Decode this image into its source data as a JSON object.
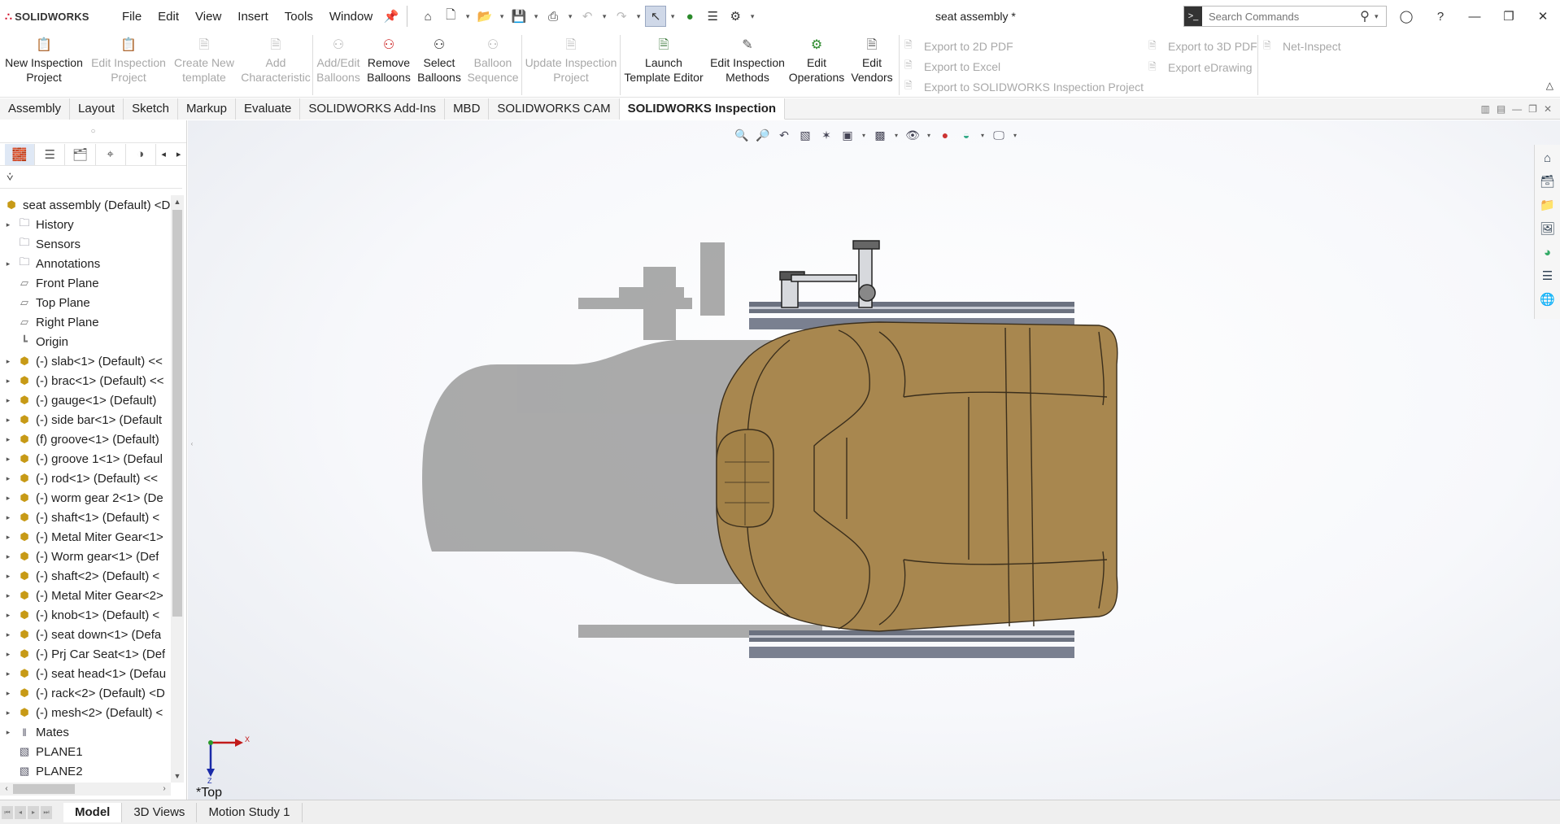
{
  "app": {
    "logo_text": "SOLIDWORKS",
    "document_title": "seat assembly *"
  },
  "menu": [
    "File",
    "Edit",
    "View",
    "Insert",
    "Tools",
    "Window"
  ],
  "search": {
    "placeholder": "Search Commands"
  },
  "ribbon": {
    "buttons": [
      {
        "label": "New Inspection Project",
        "enabled": true,
        "icon": "new-inspection-icon"
      },
      {
        "label": "Edit Inspection Project",
        "enabled": false,
        "icon": "edit-inspection-icon"
      },
      {
        "label": "Create New template",
        "enabled": false,
        "icon": "template-icon"
      },
      {
        "label": "Add Characteristic",
        "enabled": false,
        "icon": "add-characteristic-icon"
      },
      {
        "label": "Add/Edit Balloons",
        "enabled": false,
        "icon": "balloon-icon"
      },
      {
        "label": "Remove Balloons",
        "enabled": true,
        "icon": "remove-balloon-icon"
      },
      {
        "label": "Select Balloons",
        "enabled": true,
        "icon": "select-balloon-icon"
      },
      {
        "label": "Balloon Sequence",
        "enabled": false,
        "icon": "balloon-sequence-icon"
      },
      {
        "label": "Update Inspection Project",
        "enabled": false,
        "icon": "update-icon"
      },
      {
        "label": "Launch Template Editor",
        "enabled": true,
        "icon": "template-editor-icon"
      },
      {
        "label": "Edit Inspection Methods",
        "enabled": true,
        "icon": "methods-icon"
      },
      {
        "label": "Edit Operations",
        "enabled": true,
        "icon": "operations-icon"
      },
      {
        "label": "Edit Vendors",
        "enabled": true,
        "icon": "vendors-icon"
      }
    ],
    "export_list_1": [
      "Export to 2D PDF",
      "Export to Excel",
      "Export to SOLIDWORKS Inspection Project"
    ],
    "export_list_2": [
      "Export to 3D PDF",
      "Export eDrawing"
    ],
    "export_list_3": [
      "Net-Inspect"
    ]
  },
  "command_tabs": [
    {
      "label": "Assembly",
      "active": false
    },
    {
      "label": "Layout",
      "active": false
    },
    {
      "label": "Sketch",
      "active": false
    },
    {
      "label": "Markup",
      "active": false
    },
    {
      "label": "Evaluate",
      "active": false
    },
    {
      "label": "SOLIDWORKS Add-Ins",
      "active": false
    },
    {
      "label": "MBD",
      "active": false
    },
    {
      "label": "SOLIDWORKS CAM",
      "active": false
    },
    {
      "label": "SOLIDWORKS Inspection",
      "active": true
    }
  ],
  "tree": {
    "root": "seat assembly (Default) <D",
    "nodes": [
      {
        "label": "History",
        "type": "folder",
        "expandable": true
      },
      {
        "label": "Sensors",
        "type": "folder",
        "expandable": false
      },
      {
        "label": "Annotations",
        "type": "folder",
        "expandable": true
      },
      {
        "label": "Front Plane",
        "type": "plane",
        "expandable": false
      },
      {
        "label": "Top Plane",
        "type": "plane",
        "expandable": false
      },
      {
        "label": "Right Plane",
        "type": "plane",
        "expandable": false
      },
      {
        "label": "Origin",
        "type": "origin",
        "expandable": false
      },
      {
        "label": "(-) slab<1> (Default) <<",
        "type": "part",
        "expandable": true
      },
      {
        "label": "(-) brac<1> (Default) <<",
        "type": "part",
        "expandable": true
      },
      {
        "label": "(-) gauge<1> (Default)",
        "type": "part",
        "expandable": true
      },
      {
        "label": "(-) side bar<1> (Default",
        "type": "part",
        "expandable": true
      },
      {
        "label": "(f) groove<1> (Default)",
        "type": "part",
        "expandable": true
      },
      {
        "label": "(-) groove 1<1> (Defaul",
        "type": "part",
        "expandable": true
      },
      {
        "label": "(-) rod<1> (Default) <<",
        "type": "part",
        "expandable": true
      },
      {
        "label": "(-) worm gear 2<1> (De",
        "type": "part",
        "expandable": true
      },
      {
        "label": "(-) shaft<1> (Default) <",
        "type": "part",
        "expandable": true
      },
      {
        "label": "(-) Metal Miter Gear<1>",
        "type": "part",
        "expandable": true
      },
      {
        "label": "(-) Worm gear<1> (Def",
        "type": "part",
        "expandable": true
      },
      {
        "label": "(-) shaft<2> (Default) <",
        "type": "part",
        "expandable": true
      },
      {
        "label": "(-) Metal Miter Gear<2>",
        "type": "part",
        "expandable": true
      },
      {
        "label": "(-) knob<1> (Default) <",
        "type": "part",
        "expandable": true
      },
      {
        "label": "(-) seat down<1> (Defa",
        "type": "part",
        "expandable": true
      },
      {
        "label": "(-) Prj Car Seat<1> (Def",
        "type": "part",
        "expandable": true
      },
      {
        "label": "(-) seat head<1> (Defau",
        "type": "part",
        "expandable": true
      },
      {
        "label": "(-) rack<2> (Default) <D",
        "type": "asm",
        "expandable": true
      },
      {
        "label": "(-) mesh<2> (Default) <",
        "type": "part",
        "expandable": true
      },
      {
        "label": "Mates",
        "type": "mates",
        "expandable": true
      },
      {
        "label": "PLANE1",
        "type": "refplane",
        "expandable": false
      },
      {
        "label": "PLANE2",
        "type": "refplane",
        "expandable": false
      }
    ]
  },
  "viewport": {
    "view_name": "Top",
    "triad": {
      "x_label": "X",
      "z_label": "Z"
    }
  },
  "bottom_tabs": [
    {
      "label": "Model",
      "active": true
    },
    {
      "label": "3D Views",
      "active": false
    },
    {
      "label": "Motion Study 1",
      "active": false
    }
  ],
  "colors": {
    "seat_fabric": "#a8874f",
    "seat_stitch": "#3a2e1c",
    "shadow": "#8a8a8a",
    "accent": "#d0021b"
  }
}
